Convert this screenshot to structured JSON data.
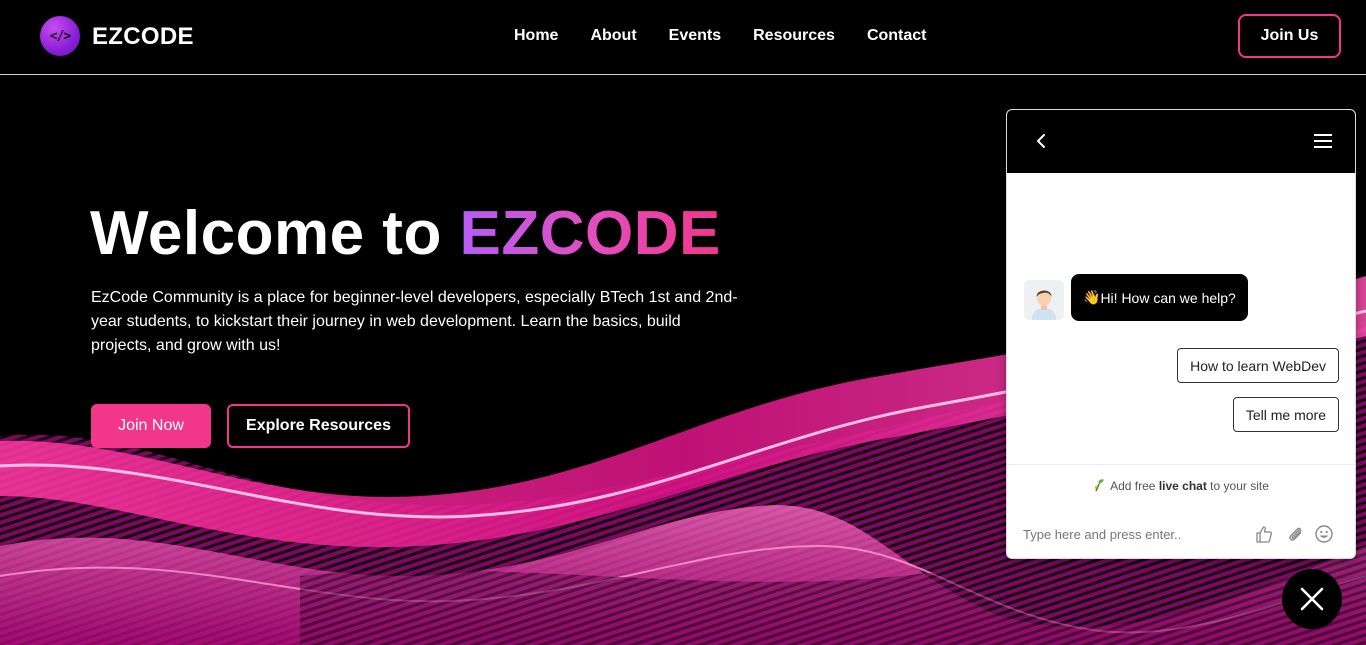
{
  "brand": {
    "logo_glyph": "</>",
    "name": "EZCODE",
    "accent_color": "#f2368a",
    "logo_color": "#8a1fd6"
  },
  "nav": {
    "items": [
      "Home",
      "About",
      "Events",
      "Resources",
      "Contact"
    ],
    "cta": "Join Us"
  },
  "hero": {
    "title_prefix": "Welcome to ",
    "title_accent": "EZCODE",
    "description": "EzCode Community is a place for beginner-level developers, especially BTech 1st and 2nd-year students, to kickstart their journey in web development. Learn the basics, build projects, and grow with us!",
    "primary_button": "Join Now",
    "secondary_button": "Explore Resources"
  },
  "chat": {
    "greeting_emoji": "👋",
    "greeting": " Hi! How can we help?",
    "quick_replies": [
      "How to learn WebDev",
      "Tell me more"
    ],
    "powered_prefix": "Add free ",
    "powered_bold": "live chat",
    "powered_suffix": " to your site",
    "input_placeholder": "Type here and press enter..",
    "icons": [
      "back-icon",
      "menu-icon",
      "thumbs-up-icon",
      "paperclip-icon",
      "emoji-icon",
      "close-icon"
    ]
  }
}
